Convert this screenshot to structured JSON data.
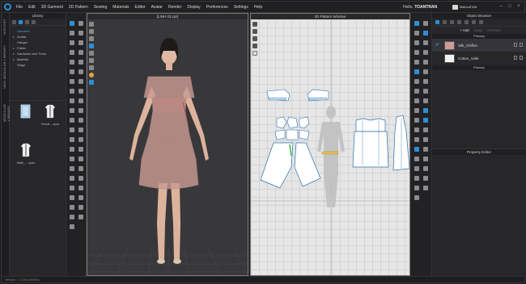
{
  "menubar": {
    "items": [
      "File",
      "Edit",
      "3D Garment",
      "2D Pattern",
      "Sewing",
      "Materials",
      "Editor",
      "Avatar",
      "Render",
      "Display",
      "Preferences",
      "Settings",
      "Help"
    ],
    "greeting": "Hello,",
    "username": "TOANTRAN",
    "mode_badge": "SIMULATION"
  },
  "left_tabs": [
    "HISTORY",
    "NEW MODULAR LIBRARY",
    "MODULAR LIBRARY"
  ],
  "library": {
    "title": "Library",
    "tree": [
      {
        "label": "Garment",
        "active": true
      },
      {
        "label": "Avatar",
        "active": false
      },
      {
        "label": "Hanger",
        "active": false
      },
      {
        "label": "Fabric",
        "active": false
      },
      {
        "label": "Hardware and Trims",
        "active": false
      },
      {
        "label": "Material",
        "active": false
      },
      {
        "label": "Stage",
        "active": false
      }
    ],
    "thumbnails": [
      {
        "caption": "..",
        "icon": "folder-icon"
      },
      {
        "caption": "Femal....zpac",
        "icon": "garment-icon"
      },
      {
        "caption": "Male_....zpac",
        "icon": "garment-icon"
      }
    ]
  },
  "viewport3d": {
    "title": "[LINH 03.zpr]"
  },
  "viewport2d": {
    "title": "2D Pattern Window"
  },
  "object_browser": {
    "title": "Object Browser",
    "add_label": "Add",
    "copy_label": "Copy",
    "remove_label": "Remove",
    "section_fabric": "Primary",
    "fabrics": [
      {
        "name": "Silk_Chiffon",
        "color": "#cf9a98",
        "selected": true
      },
      {
        "name": "Cotton_Voile",
        "color": "#f2f2f2",
        "selected": false
      }
    ],
    "section_bottom": "Primary"
  },
  "property_editor": {
    "title": "Property Editor"
  },
  "status": {
    "version": "Version: 7.1.246 (r40461)"
  },
  "colors": {
    "accent": "#2e8ed8",
    "fabric_pink": "#cf9a98"
  }
}
